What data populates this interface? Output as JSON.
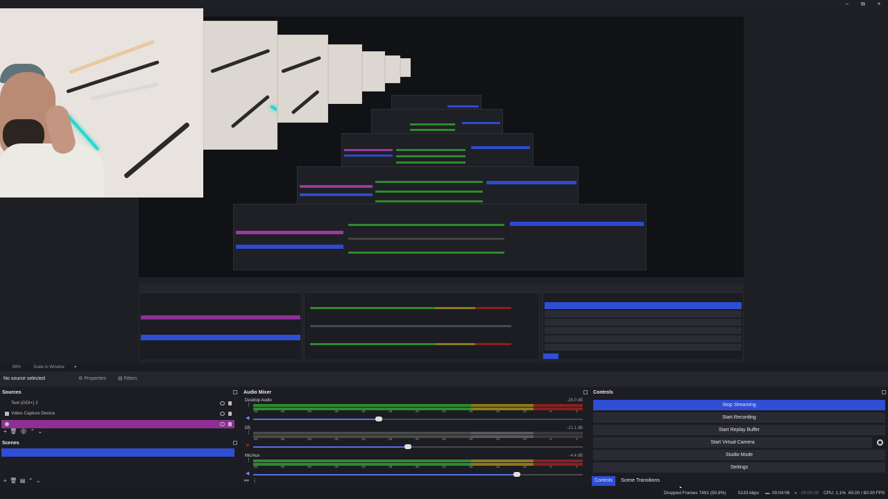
{
  "window": {
    "minimize": "–",
    "maximize": "⧉",
    "close": "×"
  },
  "canvas_bar": {
    "zoom": "88%",
    "scale": "Scale to Window"
  },
  "context": {
    "no_source": "No source selected",
    "properties": "Properties",
    "filters": "Filters"
  },
  "sources": {
    "title": "Sources",
    "items": [
      {
        "label": "Text (GDI+) 2",
        "selected": false,
        "color": ""
      },
      {
        "label": "Video Capture Device",
        "selected": false,
        "color": ""
      },
      {
        "label": "",
        "selected": true,
        "color": "#8e2f95"
      }
    ]
  },
  "scenes": {
    "title": "Scenes",
    "items": [
      {
        "label": "",
        "selected": true
      },
      {
        "label": "",
        "selected": false
      },
      {
        "label": "",
        "selected": false
      }
    ]
  },
  "mixer": {
    "title": "Audio Mixer",
    "tracks": [
      {
        "name": "Desktop Audio",
        "db": "-28.0 dB",
        "volume_fraction": 0.38,
        "muted": false
      },
      {
        "name": "D5",
        "db": "-21.1 dB",
        "volume_fraction": 0.47,
        "muted": true
      },
      {
        "name": "Mic/Aux",
        "db": "-4.4 dB",
        "volume_fraction": 0.8,
        "muted": false
      }
    ],
    "ticks": [
      "-60",
      "-55",
      "-50",
      "-45",
      "-40",
      "-35",
      "-30",
      "-25",
      "-20",
      "-15",
      "-10",
      "-5",
      "0"
    ]
  },
  "controls": {
    "title": "Controls",
    "buttons": [
      "Stop Streaming",
      "Start Recording",
      "Start Replay Buffer",
      "Start Virtual Camera",
      "Studio Mode",
      "Settings"
    ],
    "tabs": [
      "Controls",
      "Scene Transitions"
    ]
  },
  "status": {
    "dropped": "Dropped Frames 7491 (50.8%)",
    "bitrate": "5133 kbps",
    "stream_time": "00:04:06",
    "rec_time": "00:00:00",
    "cpu": "CPU: 1.1%",
    "fps": "60.00 / 60.00 FPS"
  },
  "colors": {
    "accent": "#2f4ed5",
    "source_highlight": "#8e2f95",
    "meter_green": "#2e8b2e",
    "meter_yellow": "#8c7a1d",
    "meter_red": "#8c1f1f"
  }
}
